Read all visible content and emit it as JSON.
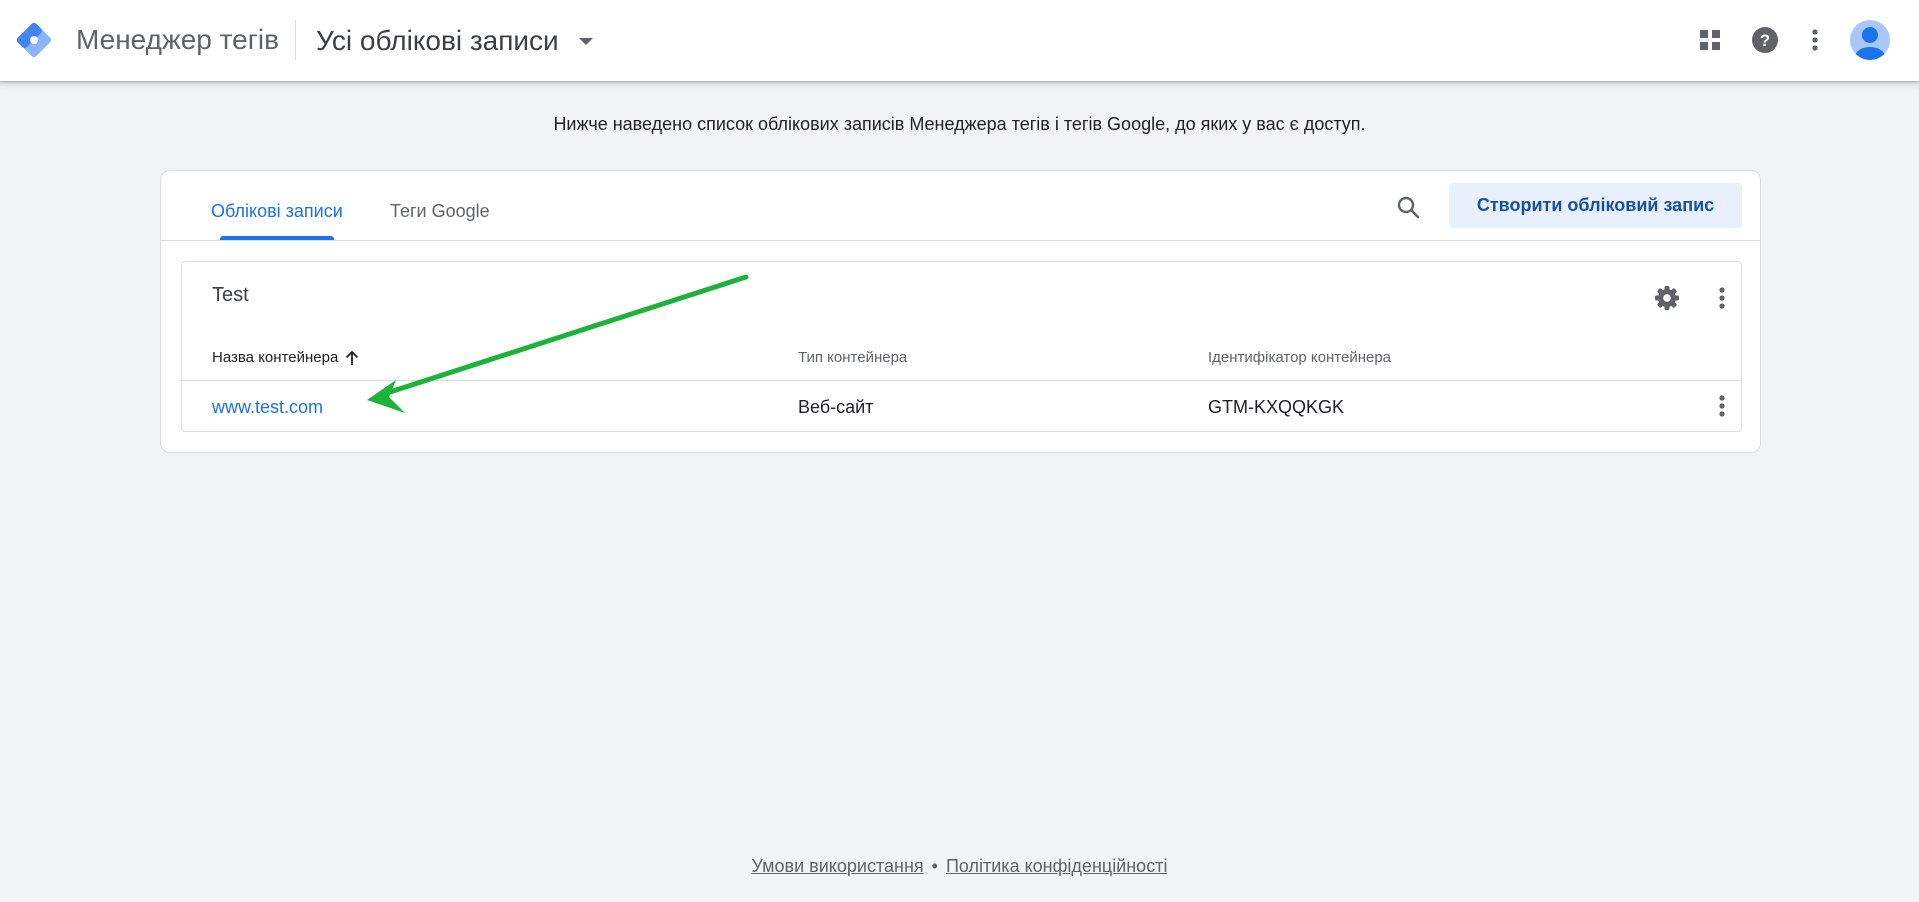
{
  "header": {
    "product_name": "Менеджер тегів",
    "account_selector": "Усі облікові записи",
    "icons": {
      "logo": "tag-manager-logo-icon",
      "dropdown": "chevron-down-icon",
      "apps": "apps-grid-icon",
      "help": "help-icon",
      "more": "more-vert-icon",
      "avatar": "account-avatar-icon"
    }
  },
  "intro_text": "Нижче наведено список облікових записів Менеджера тегів і тегів Google, до яких у вас є доступ.",
  "tabs": [
    {
      "label": "Облікові записи",
      "active": true
    },
    {
      "label": "Теги Google",
      "active": false
    }
  ],
  "toolbar": {
    "search_icon": "search-icon",
    "create_button": "Створити обліковий запис"
  },
  "account": {
    "name": "Test",
    "settings_icon": "gear-icon",
    "more_icon": "more-vert-icon",
    "columns": {
      "name": "Назва контейнера",
      "type": "Тип контейнера",
      "id": "Ідентифікатор контейнера"
    },
    "sort_icon": "arrow-up-icon",
    "containers": [
      {
        "name": "www.test.com",
        "type": "Веб-сайт",
        "id": "GTM-KXQQKGK"
      }
    ]
  },
  "annotation": {
    "arrow_color": "#1db23a"
  },
  "footer": {
    "terms": "Умови використання",
    "separator": "•",
    "privacy": "Політика конфіденційності"
  },
  "colors": {
    "background": "#f1f3f4",
    "accent_blue": "#1a73e8",
    "create_button_bg": "#e8f0fe",
    "create_button_text": "#174ea6"
  }
}
